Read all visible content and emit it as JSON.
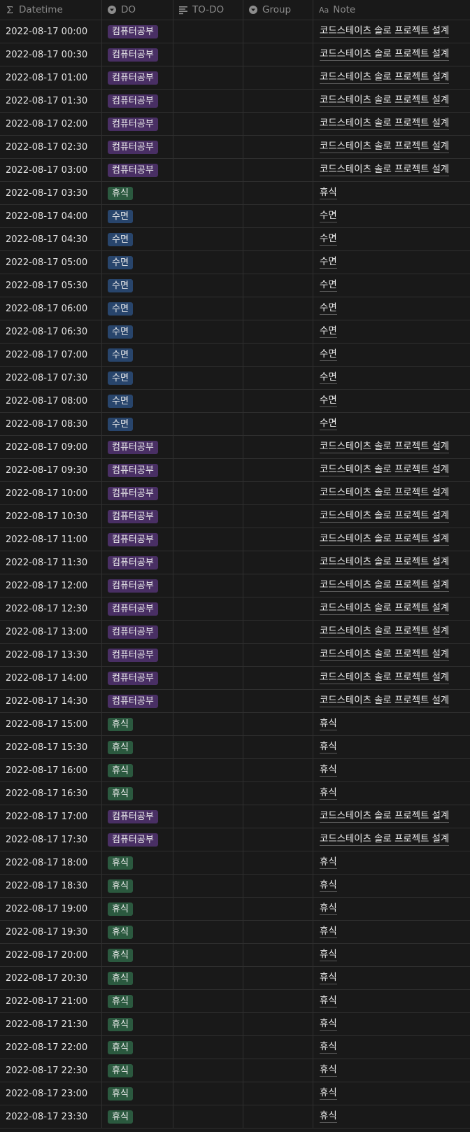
{
  "header": {
    "datetime": "Datetime",
    "do": "DO",
    "todo": "TO-DO",
    "group": "Group",
    "note": "Note",
    "note_icon_text": "Aa"
  },
  "tag_colors": {
    "컴퓨터공부": "#492f64",
    "휴식": "#2b593f",
    "수면": "#28456c"
  },
  "rows": [
    {
      "datetime": "2022-08-17 00:00",
      "do": "컴퓨터공부",
      "note": "코드스테이츠 솔로 프로젝트 설계"
    },
    {
      "datetime": "2022-08-17 00:30",
      "do": "컴퓨터공부",
      "note": "코드스테이츠 솔로 프로젝트 설계"
    },
    {
      "datetime": "2022-08-17 01:00",
      "do": "컴퓨터공부",
      "note": "코드스테이츠 솔로 프로젝트 설계"
    },
    {
      "datetime": "2022-08-17 01:30",
      "do": "컴퓨터공부",
      "note": "코드스테이츠 솔로 프로젝트 설계"
    },
    {
      "datetime": "2022-08-17 02:00",
      "do": "컴퓨터공부",
      "note": "코드스테이츠 솔로 프로젝트 설계"
    },
    {
      "datetime": "2022-08-17 02:30",
      "do": "컴퓨터공부",
      "note": "코드스테이츠 솔로 프로젝트 설계"
    },
    {
      "datetime": "2022-08-17 03:00",
      "do": "컴퓨터공부",
      "note": "코드스테이츠 솔로 프로젝트 설계"
    },
    {
      "datetime": "2022-08-17 03:30",
      "do": "휴식",
      "note": "휴식"
    },
    {
      "datetime": "2022-08-17 04:00",
      "do": "수면",
      "note": "수면"
    },
    {
      "datetime": "2022-08-17 04:30",
      "do": "수면",
      "note": "수면"
    },
    {
      "datetime": "2022-08-17 05:00",
      "do": "수면",
      "note": "수면"
    },
    {
      "datetime": "2022-08-17 05:30",
      "do": "수면",
      "note": "수면"
    },
    {
      "datetime": "2022-08-17 06:00",
      "do": "수면",
      "note": "수면"
    },
    {
      "datetime": "2022-08-17 06:30",
      "do": "수면",
      "note": "수면"
    },
    {
      "datetime": "2022-08-17 07:00",
      "do": "수면",
      "note": "수면"
    },
    {
      "datetime": "2022-08-17 07:30",
      "do": "수면",
      "note": "수면"
    },
    {
      "datetime": "2022-08-17 08:00",
      "do": "수면",
      "note": "수면"
    },
    {
      "datetime": "2022-08-17 08:30",
      "do": "수면",
      "note": "수면"
    },
    {
      "datetime": "2022-08-17 09:00",
      "do": "컴퓨터공부",
      "note": "코드스테이츠 솔로 프로젝트 설계"
    },
    {
      "datetime": "2022-08-17 09:30",
      "do": "컴퓨터공부",
      "note": "코드스테이츠 솔로 프로젝트 설계"
    },
    {
      "datetime": "2022-08-17 10:00",
      "do": "컴퓨터공부",
      "note": "코드스테이츠 솔로 프로젝트 설계"
    },
    {
      "datetime": "2022-08-17 10:30",
      "do": "컴퓨터공부",
      "note": "코드스테이츠 솔로 프로젝트 설계"
    },
    {
      "datetime": "2022-08-17 11:00",
      "do": "컴퓨터공부",
      "note": "코드스테이츠 솔로 프로젝트 설계"
    },
    {
      "datetime": "2022-08-17 11:30",
      "do": "컴퓨터공부",
      "note": "코드스테이츠 솔로 프로젝트 설계"
    },
    {
      "datetime": "2022-08-17 12:00",
      "do": "컴퓨터공부",
      "note": "코드스테이츠 솔로 프로젝트 설계"
    },
    {
      "datetime": "2022-08-17 12:30",
      "do": "컴퓨터공부",
      "note": "코드스테이츠 솔로 프로젝트 설계"
    },
    {
      "datetime": "2022-08-17 13:00",
      "do": "컴퓨터공부",
      "note": "코드스테이츠 솔로 프로젝트 설계"
    },
    {
      "datetime": "2022-08-17 13:30",
      "do": "컴퓨터공부",
      "note": "코드스테이츠 솔로 프로젝트 설계"
    },
    {
      "datetime": "2022-08-17 14:00",
      "do": "컴퓨터공부",
      "note": "코드스테이츠 솔로 프로젝트 설계"
    },
    {
      "datetime": "2022-08-17 14:30",
      "do": "컴퓨터공부",
      "note": "코드스테이츠 솔로 프로젝트 설계"
    },
    {
      "datetime": "2022-08-17 15:00",
      "do": "휴식",
      "note": "휴식"
    },
    {
      "datetime": "2022-08-17 15:30",
      "do": "휴식",
      "note": "휴식"
    },
    {
      "datetime": "2022-08-17 16:00",
      "do": "휴식",
      "note": "휴식"
    },
    {
      "datetime": "2022-08-17 16:30",
      "do": "휴식",
      "note": "휴식"
    },
    {
      "datetime": "2022-08-17 17:00",
      "do": "컴퓨터공부",
      "note": "코드스테이츠 솔로 프로젝트 설계"
    },
    {
      "datetime": "2022-08-17 17:30",
      "do": "컴퓨터공부",
      "note": "코드스테이츠 솔로 프로젝트 설계"
    },
    {
      "datetime": "2022-08-17 18:00",
      "do": "휴식",
      "note": "휴식"
    },
    {
      "datetime": "2022-08-17 18:30",
      "do": "휴식",
      "note": "휴식"
    },
    {
      "datetime": "2022-08-17 19:00",
      "do": "휴식",
      "note": "휴식"
    },
    {
      "datetime": "2022-08-17 19:30",
      "do": "휴식",
      "note": "휴식"
    },
    {
      "datetime": "2022-08-17 20:00",
      "do": "휴식",
      "note": "휴식"
    },
    {
      "datetime": "2022-08-17 20:30",
      "do": "휴식",
      "note": "휴식"
    },
    {
      "datetime": "2022-08-17 21:00",
      "do": "휴식",
      "note": "휴식"
    },
    {
      "datetime": "2022-08-17 21:30",
      "do": "휴식",
      "note": "휴식"
    },
    {
      "datetime": "2022-08-17 22:00",
      "do": "휴식",
      "note": "휴식"
    },
    {
      "datetime": "2022-08-17 22:30",
      "do": "휴식",
      "note": "휴식"
    },
    {
      "datetime": "2022-08-17 23:00",
      "do": "휴식",
      "note": "휴식"
    },
    {
      "datetime": "2022-08-17 23:30",
      "do": "휴식",
      "note": "휴식"
    }
  ]
}
